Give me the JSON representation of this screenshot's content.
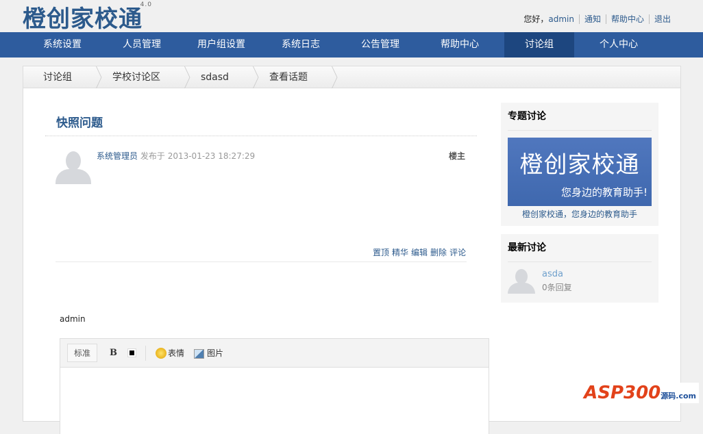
{
  "header": {
    "logo": "橙创家校通",
    "version": "4.0",
    "greeting": "您好，",
    "user": "admin",
    "links": [
      "通知",
      "帮助中心",
      "退出"
    ]
  },
  "nav": [
    "系统设置",
    "人员管理",
    "用户组设置",
    "系统日志",
    "公告管理",
    "帮助中心",
    "讨论组",
    "个人中心"
  ],
  "breadcrumb": [
    "讨论组",
    "学校讨论区",
    "sdasd",
    "查看话题"
  ],
  "topic": {
    "title": "快照问题",
    "author": "系统管理员",
    "posted_prefix": "发布于",
    "time": "2013-01-23 18:27:29",
    "floor": "楼主",
    "actions": [
      "置顶",
      "精华",
      "编辑",
      "删除",
      "评论"
    ]
  },
  "reply": {
    "username": "admin",
    "toolbar": {
      "style": "标准",
      "bold": "B",
      "emoji": "表情",
      "image": "图片"
    }
  },
  "sidebar": {
    "special": {
      "title": "专题讨论",
      "banner_title": "橙创家校通",
      "banner_slogan": "您身边的教育助手!",
      "caption": "橙创家校通，您身边的教育助手"
    },
    "latest": {
      "title": "最新讨论",
      "items": [
        {
          "name": "asda",
          "replies": "0条回复"
        }
      ]
    }
  },
  "watermark": {
    "text": "ASP300",
    "suffix": "源码.com"
  }
}
